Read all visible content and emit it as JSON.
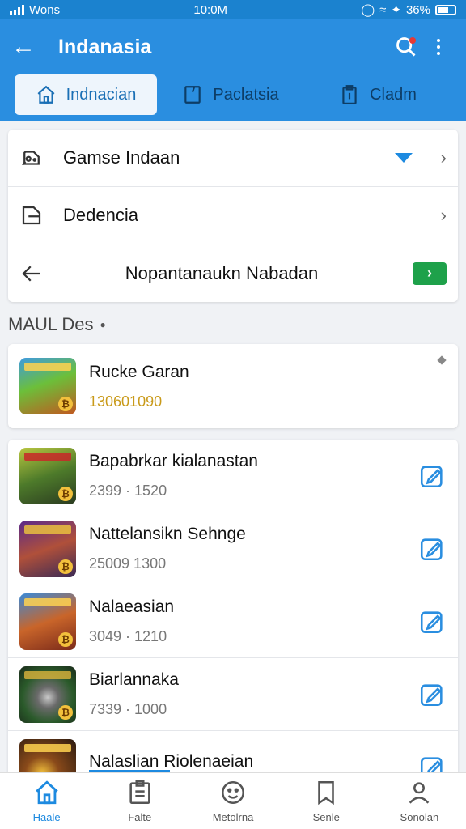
{
  "status_bar": {
    "carrier": "Wons",
    "time": "10:0M",
    "battery": "36%"
  },
  "app_bar": {
    "title": "Indanasia"
  },
  "tabs": [
    {
      "label": "Indnacian",
      "icon": "home-icon",
      "active": true
    },
    {
      "label": "Paclatsia",
      "icon": "document-icon",
      "active": false
    },
    {
      "label": "Cladm",
      "icon": "clipboard-icon",
      "active": false
    }
  ],
  "menu": [
    {
      "label": "Gamse Indaan",
      "icon": "gamepad-icon"
    },
    {
      "label": "Dedencia",
      "icon": "folder-icon"
    },
    {
      "label": "Nopantanaukn Nabadan",
      "icon": "arrow-left-icon"
    }
  ],
  "section_title": "MAUL Des",
  "featured": {
    "name": "Rucke Garan",
    "value": "130601090"
  },
  "games": [
    {
      "name": "Bapabrkar kialanastan",
      "value": "2399 · 1520"
    },
    {
      "name": "Nattelansikn Sehnge",
      "value": "25009 1300"
    },
    {
      "name": "Nalaeasian",
      "value": "3049 · 1210"
    },
    {
      "name": "Biarlannaka",
      "value": "7339 · 1000"
    },
    {
      "name": "Nalaslian Riolenaeian",
      "value": ""
    }
  ],
  "bottom_nav": [
    {
      "label": "Haale",
      "icon": "home-icon",
      "active": true
    },
    {
      "label": "Falte",
      "icon": "list-icon",
      "active": false
    },
    {
      "label": "Metolrna",
      "icon": "smiley-icon",
      "active": false
    },
    {
      "label": "Senle",
      "icon": "book-icon",
      "active": false
    },
    {
      "label": "Sonolan",
      "icon": "person-icon",
      "active": false
    }
  ],
  "colors": {
    "primary": "#2a8ee0",
    "status_bar": "#1b82cf",
    "accent_green": "#1ea14a",
    "gold": "#c99a1a"
  }
}
